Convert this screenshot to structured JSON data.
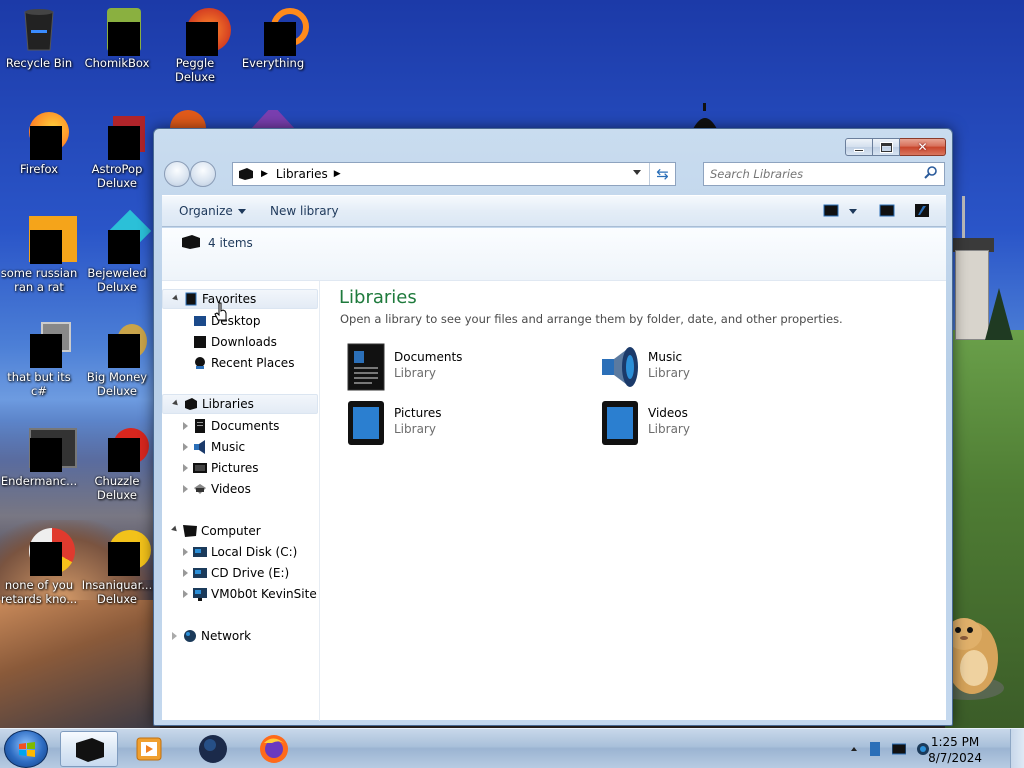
{
  "desktop": {
    "icons": [
      {
        "label": "Recycle Bin"
      },
      {
        "label": "ChomikBox"
      },
      {
        "label": "Peggle Deluxe"
      },
      {
        "label": "Everything"
      },
      {
        "label": "Firefox"
      },
      {
        "label": "AstroPop Deluxe"
      },
      {
        "label": "some russian ran a rat"
      },
      {
        "label": "Bejeweled Deluxe"
      },
      {
        "label": "that but its c#"
      },
      {
        "label": "Big Money Deluxe"
      },
      {
        "label": "Endermanc..."
      },
      {
        "label": "Chuzzle Deluxe"
      },
      {
        "label": "none of you retards kno..."
      },
      {
        "label": "Insaniquar... Deluxe"
      }
    ]
  },
  "window": {
    "address": {
      "crumb": "Libraries"
    },
    "search": {
      "placeholder": "Search Libraries"
    },
    "toolbar": {
      "organize_label": "Organize",
      "new_library_label": "New library"
    },
    "info": {
      "item_count": "4 items"
    },
    "nav": {
      "favorites": {
        "label": "Favorites",
        "children": [
          "Desktop",
          "Downloads",
          "Recent Places"
        ]
      },
      "libraries": {
        "label": "Libraries",
        "children": [
          "Documents",
          "Music",
          "Pictures",
          "Videos"
        ]
      },
      "computer": {
        "label": "Computer",
        "children": [
          "Local Disk (C:)",
          "CD Drive (E:)",
          "VM0b0t KevinSite"
        ]
      },
      "network": {
        "label": "Network"
      }
    },
    "content": {
      "title": "Libraries",
      "subtitle": "Open a library to see your files and arrange them by folder, date, and other properties.",
      "libraries": [
        {
          "name": "Documents",
          "type": "Library"
        },
        {
          "name": "Music",
          "type": "Library"
        },
        {
          "name": "Pictures",
          "type": "Library"
        },
        {
          "name": "Videos",
          "type": "Library"
        }
      ]
    }
  },
  "taskbar": {
    "time": "1:25 PM",
    "date": "8/7/2024"
  },
  "colors": {
    "library_title": "#1e7a3c",
    "toolbar_text": "#1e395b",
    "close_button": "#c8452b"
  }
}
